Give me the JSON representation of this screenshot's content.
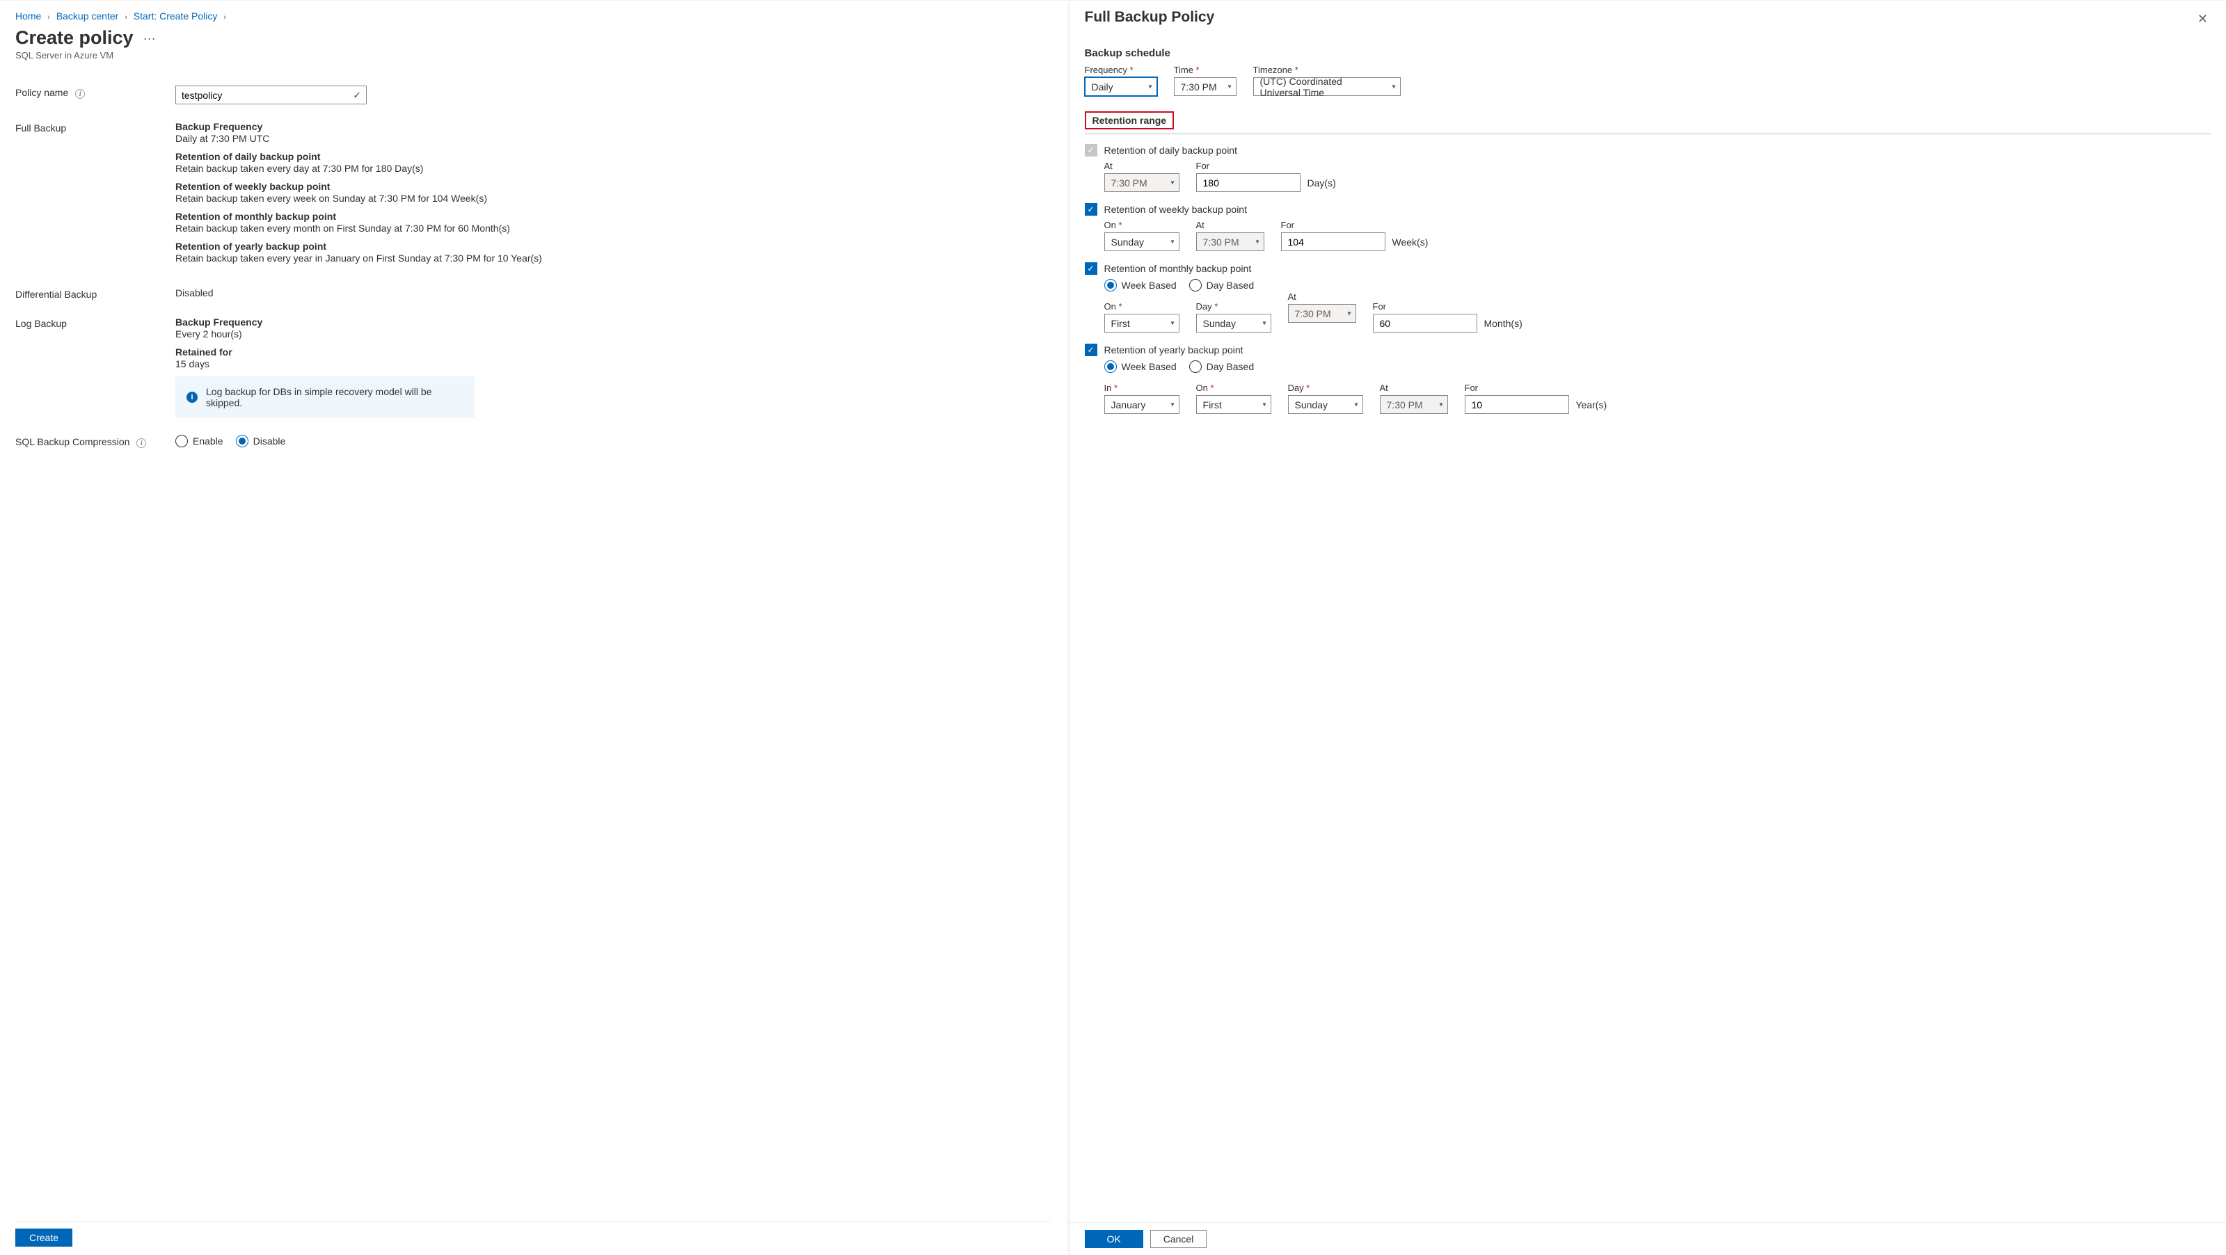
{
  "breadcrumb": {
    "home": "Home",
    "backup_center": "Backup center",
    "start": "Start: Create Policy"
  },
  "page": {
    "title": "Create policy",
    "subtitle": "SQL Server in Azure VM"
  },
  "left": {
    "policy_name_label": "Policy name",
    "policy_name_value": "testpolicy",
    "full_backup_label": "Full Backup",
    "full_backup": {
      "freq_title": "Backup Frequency",
      "freq_desc": "Daily at 7:30 PM UTC",
      "daily_title": "Retention of daily backup point",
      "daily_desc": "Retain backup taken every day at 7:30 PM for 180 Day(s)",
      "weekly_title": "Retention of weekly backup point",
      "weekly_desc": "Retain backup taken every week on Sunday at 7:30 PM for 104 Week(s)",
      "monthly_title": "Retention of monthly backup point",
      "monthly_desc": "Retain backup taken every month on First Sunday at 7:30 PM for 60 Month(s)",
      "yearly_title": "Retention of yearly backup point",
      "yearly_desc": "Retain backup taken every year in January on First Sunday at 7:30 PM for 10 Year(s)"
    },
    "diff_label": "Differential Backup",
    "diff_value": "Disabled",
    "log_label": "Log Backup",
    "log": {
      "freq_title": "Backup Frequency",
      "freq_desc": "Every 2 hour(s)",
      "ret_title": "Retained for",
      "ret_desc": "15 days",
      "banner": "Log backup for DBs in simple recovery model will be skipped."
    },
    "compression_label": "SQL Backup Compression",
    "compression": {
      "enable": "Enable",
      "disable": "Disable"
    },
    "create_btn": "Create"
  },
  "right": {
    "title": "Full Backup Policy",
    "schedule_title": "Backup schedule",
    "schedule": {
      "frequency_label": "Frequency",
      "frequency_value": "Daily",
      "time_label": "Time",
      "time_value": "7:30 PM",
      "tz_label": "Timezone",
      "tz_value": "(UTC) Coordinated Universal Time"
    },
    "retention_title": "Retention range",
    "daily": {
      "label": "Retention of daily backup point",
      "at_label": "At",
      "at_value": "7:30 PM",
      "for_label": "For",
      "for_value": "180",
      "unit": "Day(s)"
    },
    "weekly": {
      "label": "Retention of weekly backup point",
      "on_label": "On",
      "on_value": "Sunday",
      "at_label": "At",
      "at_value": "7:30 PM",
      "for_label": "For",
      "for_value": "104",
      "unit": "Week(s)"
    },
    "monthly": {
      "label": "Retention of monthly backup point",
      "week_based": "Week Based",
      "day_based": "Day Based",
      "on_label": "On",
      "on_value": "First",
      "day_label": "Day",
      "day_value": "Sunday",
      "at_label": "At",
      "at_value": "7:30 PM",
      "for_label": "For",
      "for_value": "60",
      "unit": "Month(s)"
    },
    "yearly": {
      "label": "Retention of yearly backup point",
      "week_based": "Week Based",
      "day_based": "Day Based",
      "in_label": "In",
      "in_value": "January",
      "on_label": "On",
      "on_value": "First",
      "day_label": "Day",
      "day_value": "Sunday",
      "at_label": "At",
      "at_value": "7:30 PM",
      "for_label": "For",
      "for_value": "10",
      "unit": "Year(s)"
    },
    "ok_btn": "OK",
    "cancel_btn": "Cancel"
  }
}
